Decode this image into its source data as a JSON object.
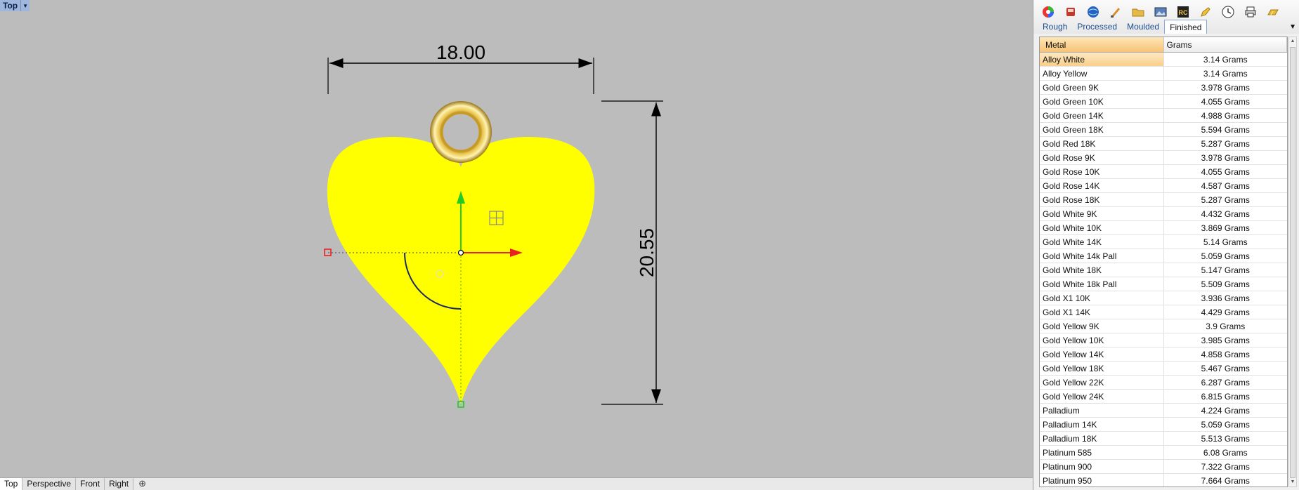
{
  "viewport": {
    "title": "Top",
    "dims": {
      "width": "18.00",
      "height": "20.55"
    }
  },
  "bottom_tabs": [
    "Top",
    "Perspective",
    "Front",
    "Right"
  ],
  "panel": {
    "tabs": [
      {
        "label": "Rough",
        "active": false
      },
      {
        "label": "Processed",
        "active": false
      },
      {
        "label": "Moulded",
        "active": false
      },
      {
        "label": "Finished",
        "active": true
      }
    ],
    "table": {
      "headers": [
        "Metal",
        "Grams"
      ],
      "rows": [
        [
          "Alloy White",
          "3.14 Grams"
        ],
        [
          "Alloy Yellow",
          "3.14 Grams"
        ],
        [
          "Gold Green 9K",
          "3.978 Grams"
        ],
        [
          "Gold Green 10K",
          "4.055 Grams"
        ],
        [
          "Gold Green 14K",
          "4.988 Grams"
        ],
        [
          "Gold Green 18K",
          "5.594 Grams"
        ],
        [
          "Gold Red 18K",
          "5.287 Grams"
        ],
        [
          "Gold Rose 9K",
          "3.978 Grams"
        ],
        [
          "Gold Rose 10K",
          "4.055 Grams"
        ],
        [
          "Gold Rose 14K",
          "4.587 Grams"
        ],
        [
          "Gold Rose 18K",
          "5.287 Grams"
        ],
        [
          "Gold White 9K",
          "4.432 Grams"
        ],
        [
          "Gold White 10K",
          "3.869 Grams"
        ],
        [
          "Gold White 14K",
          "5.14 Grams"
        ],
        [
          "Gold White 14k Pall",
          "5.059 Grams"
        ],
        [
          "Gold White 18K",
          "5.147 Grams"
        ],
        [
          "Gold White 18k Pall",
          "5.509 Grams"
        ],
        [
          "Gold X1 10K",
          "3.936 Grams"
        ],
        [
          "Gold X1 14K",
          "4.429 Grams"
        ],
        [
          "Gold Yellow 9K",
          "3.9 Grams"
        ],
        [
          "Gold Yellow 10K",
          "3.985 Grams"
        ],
        [
          "Gold Yellow 14K",
          "4.858 Grams"
        ],
        [
          "Gold Yellow 18K",
          "5.467 Grams"
        ],
        [
          "Gold Yellow 22K",
          "6.287 Grams"
        ],
        [
          "Gold Yellow 24K",
          "6.815 Grams"
        ],
        [
          "Palladium",
          "4.224 Grams"
        ],
        [
          "Palladium 14K",
          "5.059 Grams"
        ],
        [
          "Palladium 18K",
          "5.513 Grams"
        ],
        [
          "Platinum 585",
          "6.08 Grams"
        ],
        [
          "Platinum 900",
          "7.322 Grams"
        ],
        [
          "Platinum 950",
          "7.664 Grams"
        ]
      ],
      "selected_row": 0
    }
  },
  "colors": {
    "viewport_bg": "#bcbcbc",
    "heart": "#ffff00",
    "gizmo_x": "#e82222",
    "gizmo_y": "#22cc22",
    "selection": "#f7c374"
  },
  "icons": [
    "color-wheel-icon",
    "paint-bucket-icon",
    "globe-icon",
    "brush-icon",
    "folder-icon",
    "image-icon",
    "rc-logo-icon",
    "pencil-icon",
    "clock-icon",
    "printer-icon",
    "gold-bar-icon"
  ]
}
